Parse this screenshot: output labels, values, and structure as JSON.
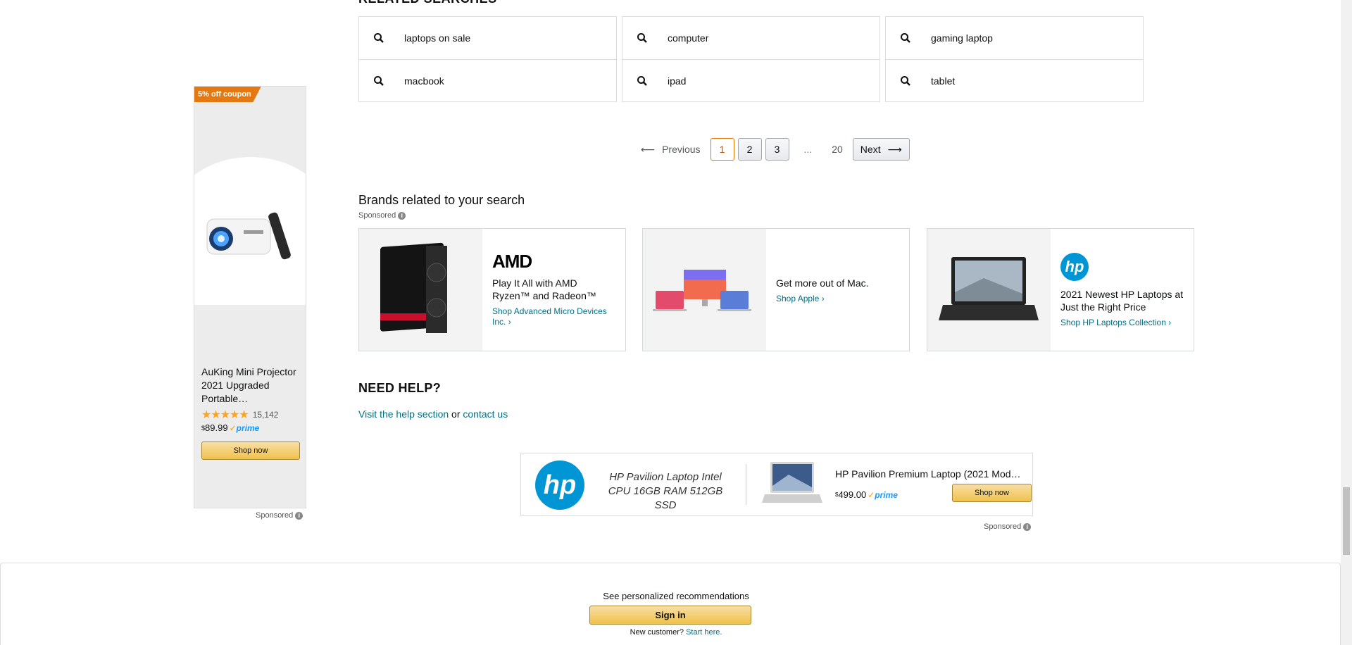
{
  "related_searches": {
    "heading": "RELATED SEARCHES",
    "columns": [
      [
        "laptops on sale",
        "macbook"
      ],
      [
        "computer",
        "ipad"
      ],
      [
        "gaming laptop",
        "tablet"
      ]
    ],
    "icon": "search-icon"
  },
  "left_ad": {
    "coupon": "5% off coupon",
    "title": "AuKing Mini Projector 2021 Upgraded Portable…",
    "rating_count": "15,142",
    "rating": 4.5,
    "price_symbol": "$",
    "price": "89.99",
    "prime_label": "prime",
    "shop_button": "Shop now",
    "sponsored": "Sponsored"
  },
  "pagination": {
    "previous": "Previous",
    "pages": [
      "1",
      "2",
      "3"
    ],
    "current": "1",
    "ellipsis": "...",
    "last": "20",
    "next": "Next"
  },
  "brands": {
    "title": "Brands related to your search",
    "sponsored": "Sponsored",
    "cards": [
      {
        "logo": "AMD",
        "headline": "Play It All with AMD Ryzen™ and Radeon™",
        "link": "Shop Advanced Micro Devices Inc."
      },
      {
        "logo": "",
        "headline": "Get more out of Mac.",
        "link": "Shop Apple"
      },
      {
        "logo": "hp",
        "headline": "2021 Newest HP Laptops at Just the Right Price",
        "link": "Shop HP Laptops Collection"
      }
    ]
  },
  "help": {
    "title": "NEED HELP?",
    "link_help": "Visit the help section",
    "or": "or",
    "link_contact": "contact us"
  },
  "hp_banner": {
    "logo": "hp",
    "tagline": "HP Pavilion Laptop Intel CPU 16GB RAM 512GB SSD",
    "title": "HP Pavilion Premium Laptop (2021 Mod…",
    "price_symbol": "$",
    "price": "499.00",
    "prime_label": "prime",
    "shop_button": "Shop now",
    "sponsored": "Sponsored"
  },
  "signin": {
    "prompt": "See personalized recommendations",
    "button": "Sign in",
    "new_customer": "New customer?",
    "start_here": "Start here."
  },
  "colors": {
    "link": "#007185",
    "accent_orange": "#e47911",
    "button_yellow": "#f0c14b",
    "hp_blue": "#0096d6"
  }
}
